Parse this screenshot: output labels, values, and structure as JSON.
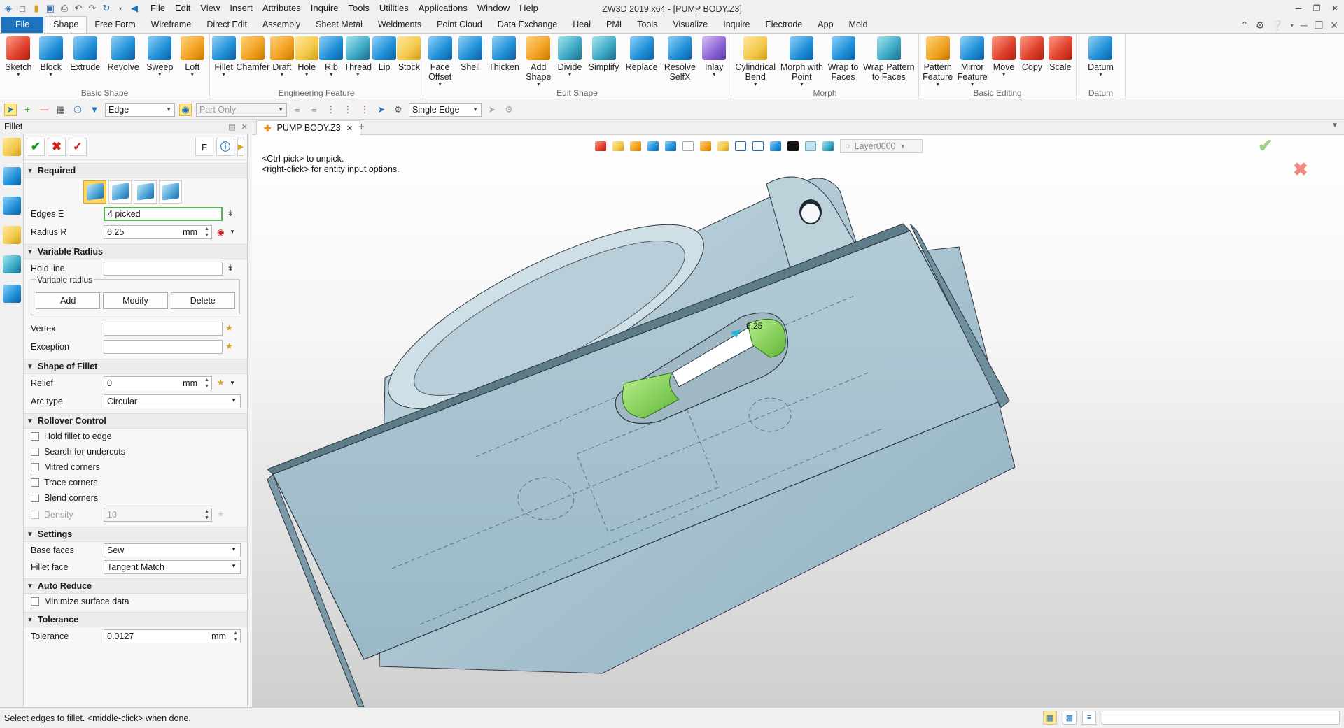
{
  "window": {
    "title": "ZW3D 2019  x64 - [PUMP BODY.Z3]",
    "min": "─",
    "restore": "❐",
    "close": "✕"
  },
  "menu": [
    "File",
    "Edit",
    "View",
    "Insert",
    "Attributes",
    "Inquire",
    "Tools",
    "Utilities",
    "Applications",
    "Window",
    "Help"
  ],
  "ribbon_tabs": [
    "File",
    "Shape",
    "Free Form",
    "Wireframe",
    "Direct Edit",
    "Assembly",
    "Sheet Metal",
    "Weldments",
    "Point Cloud",
    "Data Exchange",
    "Heal",
    "PMI",
    "Tools",
    "Visualize",
    "Inquire",
    "Electrode",
    "App",
    "Mold"
  ],
  "ribbon_groups": [
    {
      "title": "Basic Shape",
      "buttons": [
        {
          "label": "Sketch",
          "drop": "▾",
          "icon": "sketch-icon",
          "color": "red"
        },
        {
          "label": "Block",
          "drop": "▾",
          "icon": "block-icon",
          "color": "blue"
        },
        {
          "label": "Extrude",
          "drop": "",
          "icon": "extrude-icon",
          "color": "blue"
        },
        {
          "label": "Revolve",
          "drop": "",
          "icon": "revolve-icon",
          "color": "blue"
        },
        {
          "label": "Sweep",
          "drop": "▾",
          "icon": "sweep-icon",
          "color": "blue"
        },
        {
          "label": "Loft",
          "drop": "▾",
          "icon": "loft-icon",
          "color": "orange"
        }
      ]
    },
    {
      "title": "Engineering Feature",
      "buttons": [
        {
          "label": "Fillet",
          "drop": "▾",
          "icon": "fillet-icon",
          "color": "blue"
        },
        {
          "label": "Chamfer",
          "drop": "",
          "icon": "chamfer-icon",
          "color": "orange"
        },
        {
          "label": "Draft",
          "drop": "▾",
          "icon": "draft-icon",
          "color": "orange"
        },
        {
          "label": "Hole",
          "drop": "▾",
          "icon": "hole-icon",
          "color": "yellow"
        },
        {
          "label": "Rib",
          "drop": "▾",
          "icon": "rib-icon",
          "color": "blue"
        },
        {
          "label": "Thread",
          "drop": "▾",
          "icon": "thread-icon",
          "color": "teal"
        },
        {
          "label": "Lip",
          "drop": "",
          "icon": "lip-icon",
          "color": "blue"
        },
        {
          "label": "Stock",
          "drop": "",
          "icon": "stock-icon",
          "color": "yellow"
        }
      ]
    },
    {
      "title": "Edit Shape",
      "buttons": [
        {
          "label": "Face\nOffset",
          "drop": "▾",
          "icon": "face-offset-icon",
          "color": "blue"
        },
        {
          "label": "Shell",
          "drop": "",
          "icon": "shell-icon",
          "color": "blue"
        },
        {
          "label": "Thicken",
          "drop": "",
          "icon": "thicken-icon",
          "color": "blue"
        },
        {
          "label": "Add\nShape",
          "drop": "▾",
          "icon": "add-shape-icon",
          "color": "orange"
        },
        {
          "label": "Divide",
          "drop": "▾",
          "icon": "divide-icon",
          "color": "teal"
        },
        {
          "label": "Simplify",
          "drop": "",
          "icon": "simplify-icon",
          "color": "teal"
        },
        {
          "label": "Replace",
          "drop": "",
          "icon": "replace-icon",
          "color": "blue"
        },
        {
          "label": "Resolve\nSelfX",
          "drop": "",
          "icon": "resolve-selfx-icon",
          "color": "blue"
        },
        {
          "label": "Inlay",
          "drop": "▾",
          "icon": "inlay-icon",
          "color": "purple"
        }
      ]
    },
    {
      "title": "Morph",
      "buttons": [
        {
          "label": "Cylindrical\nBend",
          "drop": "▾",
          "icon": "cylindrical-bend-icon",
          "color": "yellow"
        },
        {
          "label": "Morph with\nPoint",
          "drop": "▾",
          "icon": "morph-point-icon",
          "color": "blue"
        },
        {
          "label": "Wrap to\nFaces",
          "drop": "",
          "icon": "wrap-faces-icon",
          "color": "blue"
        },
        {
          "label": "Wrap Pattern\nto Faces",
          "drop": "",
          "icon": "wrap-pattern-icon",
          "color": "teal"
        }
      ]
    },
    {
      "title": "Basic Editing",
      "buttons": [
        {
          "label": "Pattern\nFeature",
          "drop": "▾",
          "icon": "pattern-feature-icon",
          "color": "orange"
        },
        {
          "label": "Mirror\nFeature",
          "drop": "▾",
          "icon": "mirror-feature-icon",
          "color": "blue"
        },
        {
          "label": "Move",
          "drop": "▾",
          "icon": "move-icon",
          "color": "red"
        },
        {
          "label": "Copy",
          "drop": "",
          "icon": "copy-icon",
          "color": "red"
        },
        {
          "label": "Scale",
          "drop": "",
          "icon": "scale-icon",
          "color": "red"
        }
      ]
    },
    {
      "title": "Datum",
      "buttons": [
        {
          "label": "Datum",
          "drop": "▾",
          "icon": "datum-icon",
          "color": "blue"
        }
      ]
    }
  ],
  "filter_bar": {
    "filter_value": "Edge",
    "scope_value": "Part Only",
    "pick_mode_value": "Single Edge"
  },
  "panel": {
    "title": "Fillet",
    "sections": {
      "required": "Required",
      "variable_radius": "Variable Radius",
      "shape_of_fillet": "Shape of Fillet",
      "rollover_control": "Rollover Control",
      "settings": "Settings",
      "auto_reduce": "Auto Reduce",
      "tolerance": "Tolerance"
    },
    "edges_label": "Edges E",
    "edges_value": "4 picked",
    "radius_label": "Radius R",
    "radius_value": "6.25",
    "unit": "mm",
    "hold_line_label": "Hold line",
    "variable_radius_group": "Variable radius",
    "add": "Add",
    "modify": "Modify",
    "delete": "Delete",
    "vertex_label": "Vertex",
    "exception_label": "Exception",
    "relief_label": "Relief",
    "relief_value": "0",
    "arc_type_label": "Arc type",
    "arc_type_value": "Circular",
    "rollover": [
      "Hold fillet to edge",
      "Search for undercuts",
      "Mitred corners",
      "Trace corners",
      "Blend corners"
    ],
    "density_label": "Density",
    "density_value": "10",
    "base_faces_label": "Base faces",
    "base_faces_value": "Sew",
    "fillet_face_label": "Fillet face",
    "fillet_face_value": "Tangent Match",
    "minimize_label": "Minimize surface data",
    "tolerance_label": "Tolerance",
    "tolerance_value": "0.0127",
    "f_button": "F"
  },
  "doc_tab": {
    "name": "PUMP BODY.Z3",
    "close": "✕",
    "add": "+"
  },
  "viewport": {
    "layer": "Layer0000",
    "hint1": "<Ctrl-pick> to unpick.",
    "hint2": "<right-click> for entity input options.",
    "ok_mark": "✔",
    "cancel_mark": "✖",
    "radius_tag": "6.25"
  },
  "status": {
    "text": "Select edges to fillet.  <middle-click> when done."
  },
  "colors": {
    "file_tab": "#1e73be",
    "part_fill": "#a9c3cf",
    "fillet_face": "#7dd35a",
    "ok": "#9fd08a",
    "cancel": "#f08a80"
  }
}
